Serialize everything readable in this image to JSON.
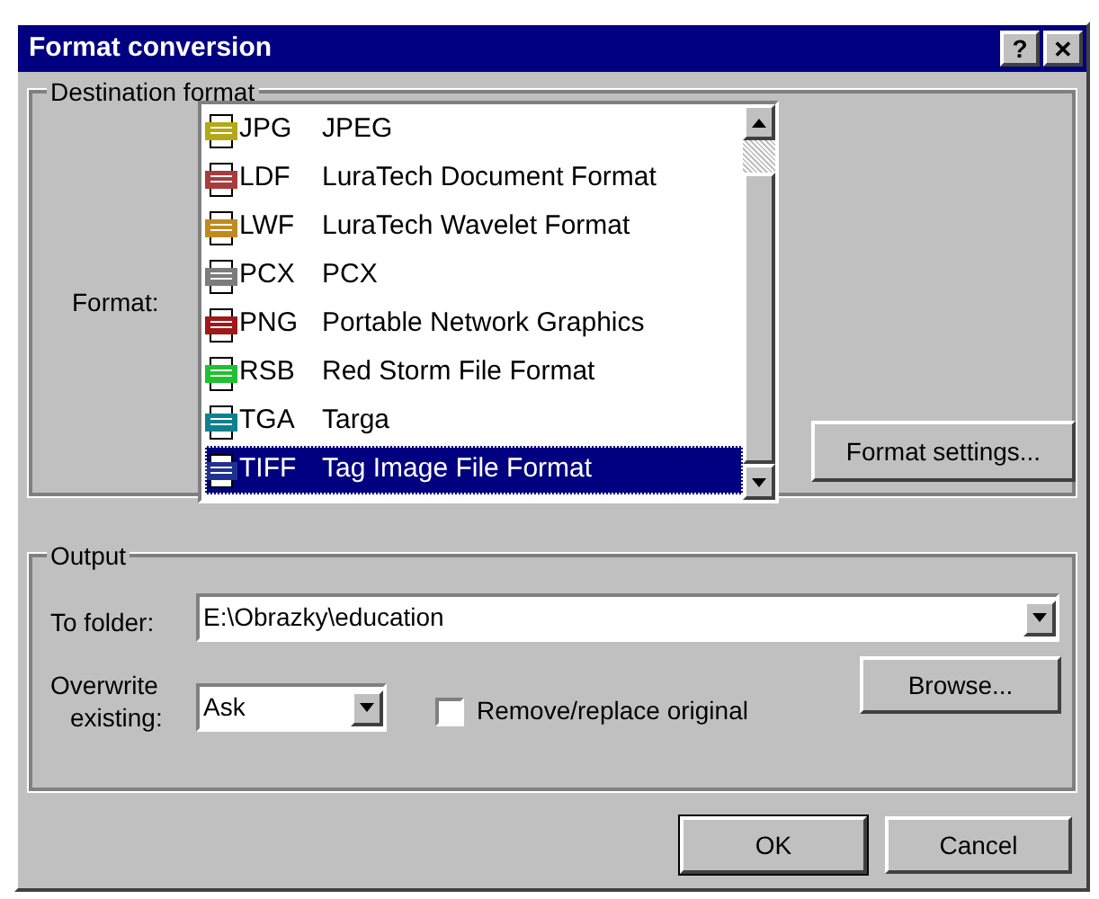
{
  "window": {
    "title": "Format conversion",
    "help_button": "?",
    "close_button": "✕"
  },
  "destination": {
    "legend": "Destination format",
    "format_label": "Format:",
    "formats": [
      {
        "ext": "JPG",
        "name": "JPEG",
        "color": "#b4a818",
        "selected": false
      },
      {
        "ext": "LDF",
        "name": "LuraTech Document Format",
        "color": "#a83c3c",
        "selected": false
      },
      {
        "ext": "LWF",
        "name": "LuraTech Wavelet Format",
        "color": "#c08a20",
        "selected": false
      },
      {
        "ext": "PCX",
        "name": "PCX",
        "color": "#7c7c7c",
        "selected": false
      },
      {
        "ext": "PNG",
        "name": "Portable Network Graphics",
        "color": "#a01818",
        "selected": false
      },
      {
        "ext": "RSB",
        "name": "Red Storm File Format",
        "color": "#20c030",
        "selected": false
      },
      {
        "ext": "TGA",
        "name": "Targa",
        "color": "#108090",
        "selected": false
      },
      {
        "ext": "TIFF",
        "name": "Tag Image File Format",
        "color": "#203090",
        "selected": true
      }
    ],
    "settings_button": "Format settings..."
  },
  "output": {
    "legend": "Output",
    "folder_label": "To folder:",
    "folder": "E:\\Obrazky\\education",
    "overwrite_label_1": "Overwrite",
    "overwrite_label_2": "existing:",
    "overwrite": "Ask",
    "remove_original": {
      "label": "Remove/replace original",
      "checked": false
    },
    "browse_button": "Browse..."
  },
  "buttons": [
    "OK",
    "Cancel"
  ]
}
